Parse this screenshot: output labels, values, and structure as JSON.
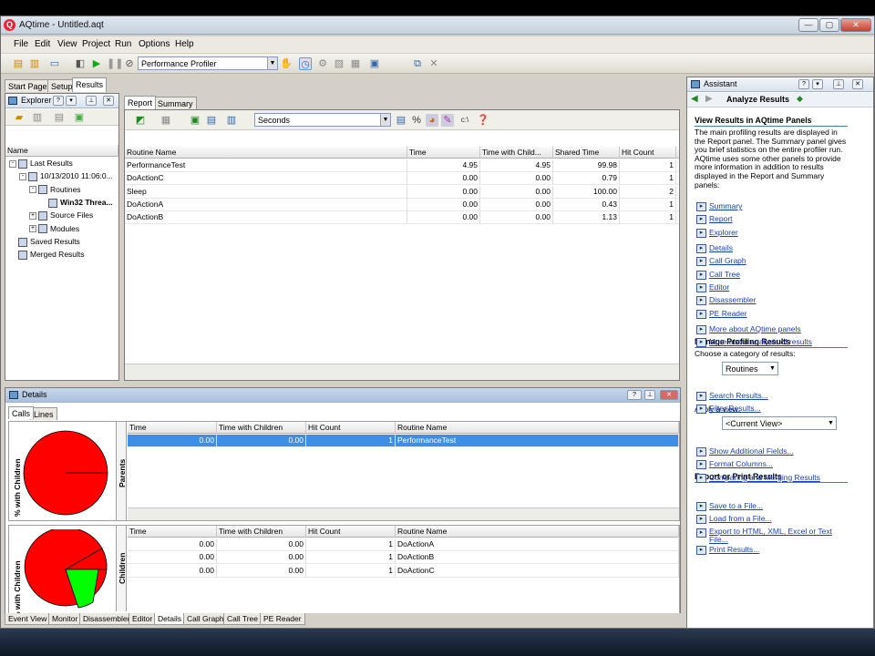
{
  "window": {
    "title": "AQtime - Untitled.aqt",
    "app_icon": "Q"
  },
  "menu": [
    "File",
    "Edit",
    "View",
    "Project",
    "Run",
    "Options",
    "Help"
  ],
  "toolbar": {
    "profiler": "Performance Profiler"
  },
  "left_tabs": [
    "Start Page",
    "Setup",
    "Results"
  ],
  "explorer": {
    "title": "Explorer",
    "column": "Name",
    "tree": [
      {
        "label": "Last Results",
        "indent": 0,
        "exp": "-"
      },
      {
        "label": "10/13/2010 11:06:0...",
        "indent": 1,
        "exp": "-"
      },
      {
        "label": "Routines",
        "indent": 2,
        "exp": "-"
      },
      {
        "label": "Win32 Threa...",
        "indent": 3,
        "exp": "",
        "bold": true
      },
      {
        "label": "Source Files",
        "indent": 2,
        "exp": "+"
      },
      {
        "label": "Modules",
        "indent": 2,
        "exp": "+"
      },
      {
        "label": "Saved Results",
        "indent": 0,
        "exp": ""
      },
      {
        "label": "Merged Results",
        "indent": 0,
        "exp": ""
      }
    ]
  },
  "report": {
    "tabs": [
      "Report",
      "Summary"
    ],
    "units": "Seconds",
    "columns": [
      "Routine Name",
      "Time",
      "Time with Child...",
      "Shared Time",
      "Hit Count"
    ],
    "rows": [
      [
        "PerformanceTest",
        "4.95",
        "4.95",
        "99.98",
        "1"
      ],
      [
        "DoActionC",
        "0.00",
        "0.00",
        "0.79",
        "1"
      ],
      [
        "Sleep",
        "0.00",
        "0.00",
        "100.00",
        "2"
      ],
      [
        "DoActionA",
        "0.00",
        "0.00",
        "0.43",
        "1"
      ],
      [
        "DoActionB",
        "0.00",
        "0.00",
        "1.13",
        "1"
      ]
    ]
  },
  "details": {
    "title": "Details",
    "tabs": [
      "Calls",
      "Lines"
    ],
    "pie_label": "% with Children",
    "parents": {
      "label": "Parents",
      "columns": [
        "Time",
        "Time with Children",
        "Hit Count",
        "Routine Name"
      ],
      "rows": [
        [
          "0.00",
          "0.00",
          "1",
          "PerformanceTest"
        ]
      ]
    },
    "children": {
      "label": "Children",
      "columns": [
        "Time",
        "Time with Children",
        "Hit Count",
        "Routine Name"
      ],
      "rows": [
        [
          "0.00",
          "0.00",
          "1",
          "DoActionA"
        ],
        [
          "0.00",
          "0.00",
          "1",
          "DoActionB"
        ],
        [
          "0.00",
          "0.00",
          "1",
          "DoActionC"
        ]
      ]
    },
    "colors": {
      "pie_main": "#ff0000",
      "pie_slice": "#00ff00"
    }
  },
  "bottom_tabs": [
    "Event View",
    "Monitor",
    "Disassembler",
    "Editor",
    "Details",
    "Call Graph",
    "Call Tree",
    "PE Reader"
  ],
  "assistant": {
    "title": "Assistant",
    "header": "Analyze Results",
    "sec1": "View Results in AQtime Panels",
    "sec1_text": "The main profiling results are displayed in the Report panel. The Summary panel gives you brief statistics on the entire profiler run. AQtime uses some other panels to provide more information in addition to results displayed in the Report and Summary panels:",
    "links1": [
      "Summary",
      "Report",
      "Explorer"
    ],
    "links2": [
      "Details",
      "Call Graph",
      "Call Tree",
      "Editor",
      "Disassembler",
      "PE Reader"
    ],
    "links3": [
      "More about AQtime panels",
      "More about analysis of results"
    ],
    "sec2": "Manage Profiling Results",
    "choose": "Choose a category of results:",
    "category": "Routines",
    "links4": [
      "Search Results...",
      "Filter Results..."
    ],
    "apply": "Apply a view:",
    "view": "<Current View>",
    "links5": [
      "Show Additional Fields...",
      "Format Columns...",
      "Comparing and Merging Results"
    ],
    "sec3": "Export or Print Results",
    "links6": [
      "Save to a File...",
      "Load from a File...",
      "Export to HTML, XML, Excel or Text File...",
      "Print Results..."
    ]
  }
}
